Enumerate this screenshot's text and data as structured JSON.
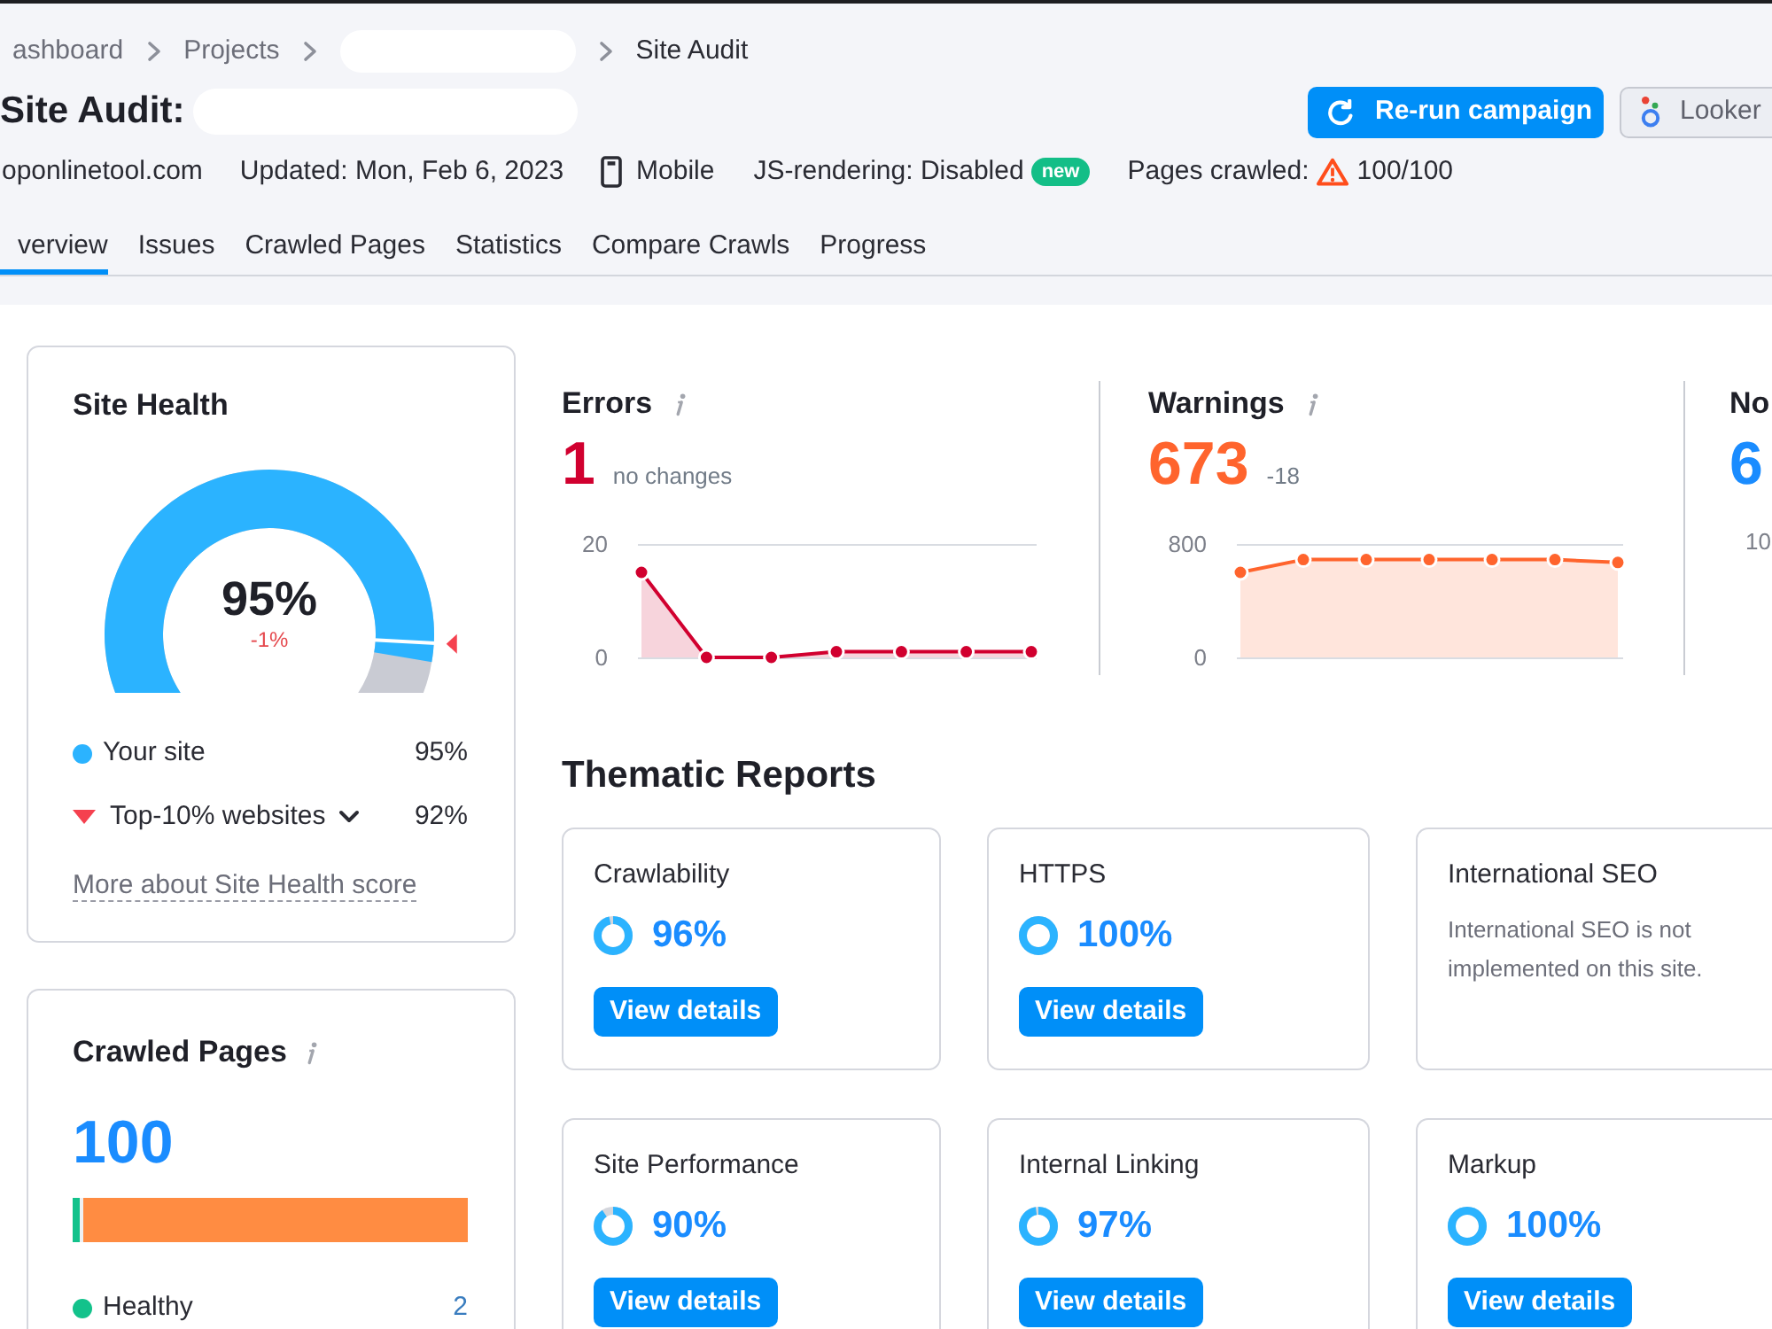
{
  "breadcrumbs": [
    {
      "kind": "link",
      "label": "ashboard"
    },
    {
      "kind": "link",
      "label": "Projects"
    },
    {
      "kind": "redacted"
    },
    {
      "kind": "current",
      "label": "Site Audit"
    }
  ],
  "title": {
    "text": "Site Audit:",
    "redacted": true
  },
  "buttons": [
    {
      "kind": "primary",
      "label": "Re-run campaign"
    },
    {
      "kind": "secondary",
      "label": "Looker"
    }
  ],
  "meta": {
    "domain": "oponlinetool.com",
    "updated": "Updated: Mon, Feb 6, 2023",
    "device": "Mobile",
    "js_rendering": "JS-rendering: Disabled",
    "js_badge": "new",
    "pages_crawled_label": "Pages crawled:",
    "pages_crawled": "100/100"
  },
  "tabs": [
    {
      "label": "verview",
      "selected": true
    },
    {
      "label": "Issues",
      "selected": false
    },
    {
      "label": "Crawled Pages",
      "selected": false
    },
    {
      "label": "Statistics",
      "selected": false
    },
    {
      "label": "Compare Crawls",
      "selected": false
    },
    {
      "label": "Progress",
      "selected": false
    }
  ],
  "site_health": {
    "title": "Site Health",
    "gauge": {
      "level": 0.95,
      "benchmark": {
        "level": 0.92
      }
    },
    "score": "95%",
    "change": "-1%",
    "legend": [
      {
        "kind": "site",
        "label": "Your site",
        "value": "95%"
      },
      {
        "kind": "benchmark",
        "label": "Top-10% websites",
        "value": "92%"
      }
    ],
    "link": "More about Site Health score"
  },
  "crawled_pages": {
    "title": "Crawled Pages",
    "total": "100",
    "bar": [
      {
        "level": 0.02,
        "color": "#13c28b"
      },
      {
        "level": 0.98,
        "color": "#ff8c42"
      }
    ],
    "legend": [
      {
        "label": "Healthy",
        "value": "2",
        "color": "#13c28b"
      }
    ]
  },
  "issues": [
    {
      "kind": "chart",
      "title": "Errors",
      "value": "1",
      "color": "#d1002f",
      "change": "no changes",
      "chart_data": [
        {
          "type": "area",
          "categories": [
            null,
            null,
            null,
            null,
            null,
            null,
            null
          ],
          "values": [
            15,
            0,
            0,
            1,
            1,
            1,
            1
          ],
          "color": "#d1002f",
          "ylim": [
            0,
            20
          ],
          "yticks": [
            0,
            20
          ],
          "marker": "circle"
        }
      ]
    },
    {
      "kind": "chart",
      "title": "Warnings",
      "value": "673",
      "color": "#ff642d",
      "change": "-18",
      "chart_data": [
        {
          "type": "area",
          "categories": [
            null,
            null,
            null,
            null,
            null,
            null,
            null
          ],
          "values": [
            600,
            690,
            690,
            690,
            690,
            690,
            670
          ],
          "color": "#ff642d",
          "ylim": [
            0,
            800
          ],
          "yticks": [
            0,
            800
          ],
          "marker": "circle"
        }
      ]
    },
    {
      "kind": "partial",
      "title": "No",
      "value": "6",
      "color": "#1a8cff",
      "tick": "10"
    }
  ],
  "thematic": {
    "title": "Thematic Reports",
    "reports": [
      {
        "kind": "score",
        "title": "Crawlability",
        "level": 0.96,
        "percent": "96%",
        "button": "View details"
      },
      {
        "kind": "score",
        "title": "HTTPS",
        "level": 1,
        "percent": "100%",
        "button": "View details"
      },
      {
        "kind": "note",
        "title": "International SEO",
        "note": "International SEO is not implemented on this site."
      },
      {
        "kind": "score",
        "title": "Site Performance",
        "level": 0.9,
        "percent": "90%",
        "button": "View details"
      },
      {
        "kind": "score",
        "title": "Internal Linking",
        "level": 0.97,
        "percent": "97%",
        "button": "View details"
      },
      {
        "kind": "score",
        "title": "Markup",
        "level": 1,
        "percent": "100%",
        "button": "View details"
      }
    ]
  }
}
